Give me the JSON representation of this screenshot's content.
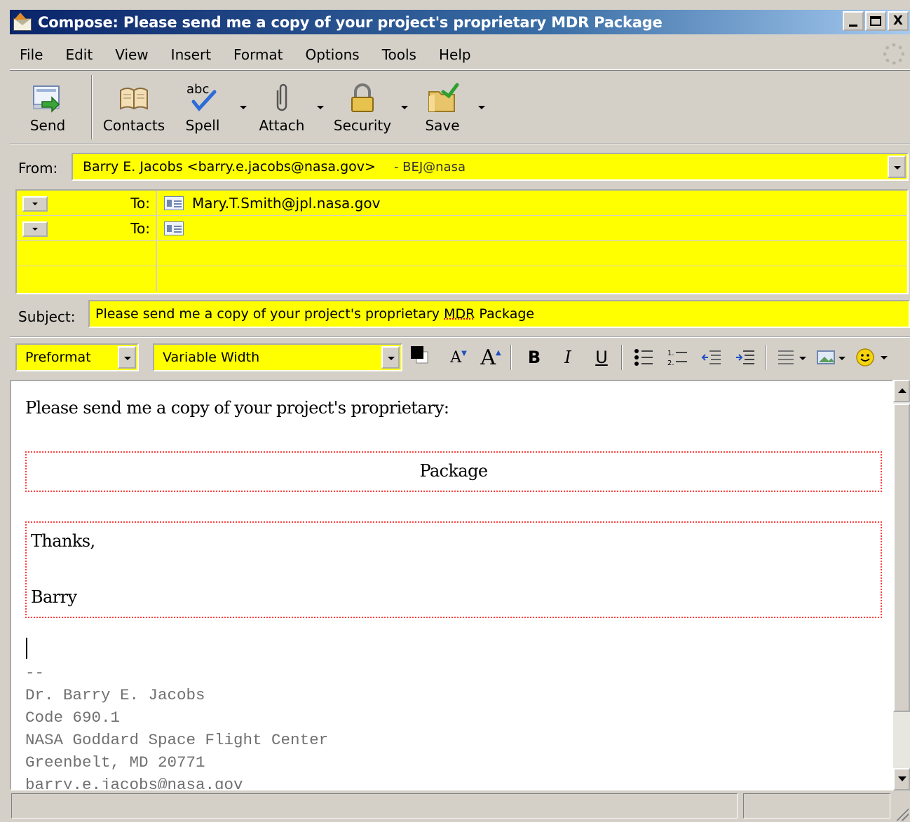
{
  "window": {
    "title": "Compose: Please send me a copy of your project's proprietary MDR Package",
    "controls": {
      "minimize": "_",
      "maximize": "□",
      "close": "X"
    }
  },
  "menu": [
    "File",
    "Edit",
    "View",
    "Insert",
    "Format",
    "Options",
    "Tools",
    "Help"
  ],
  "toolbar": {
    "send": "Send",
    "contacts": "Contacts",
    "spell": "Spell",
    "attach": "Attach",
    "security": "Security",
    "save": "Save",
    "spell_icon_text": "abc"
  },
  "header": {
    "from_label": "From:",
    "from_value": "Barry E. Jacobs <barry.e.jacobs@nasa.gov>",
    "from_extra": "- BEJ@nasa",
    "recipients": [
      {
        "type": "To:",
        "address": "Mary.T.Smith@jpl.nasa.gov"
      },
      {
        "type": "To:",
        "address": ""
      }
    ],
    "subject_label": "Subject:",
    "subject_before": "Please send me a copy of your project's proprietary ",
    "subject_mdr": "MDR",
    "subject_after": " Package"
  },
  "format_bar": {
    "paragraph_style": "Preformat",
    "font": "Variable Width",
    "bold": "B",
    "italic": "I",
    "underline": "U"
  },
  "body": {
    "line1": "Please send me a copy of your project's proprietary:",
    "package_box": "Package",
    "thanks": "Thanks,",
    "name": "Barry",
    "sig_sep": "--",
    "signature": [
      "Dr. Barry E. Jacobs",
      "Code 690.1",
      "NASA Goddard Space Flight Center",
      "Greenbelt, MD 20771",
      "barry.e.jacobs@nasa.gov"
    ]
  },
  "colors": {
    "field_bg": "#ffff00",
    "title_bar": "#0a246a",
    "dotted_border": "#ff4040"
  }
}
